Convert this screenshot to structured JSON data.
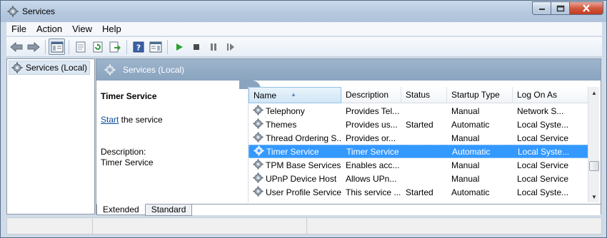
{
  "window": {
    "title": "Services",
    "controls": {
      "minimize": "minimize",
      "maximize": "maximize",
      "close": "close"
    }
  },
  "menu": [
    "File",
    "Action",
    "View",
    "Help"
  ],
  "toolbar": [
    {
      "icon": "back-arrow-icon"
    },
    {
      "icon": "forward-arrow-icon"
    },
    {
      "icon": "show-hide-console-tree-icon",
      "active": true
    },
    {
      "icon": "properties-icon"
    },
    {
      "icon": "refresh-icon"
    },
    {
      "icon": "export-list-icon"
    },
    {
      "icon": "help-icon"
    },
    {
      "icon": "show-action-pane-icon"
    },
    {
      "icon": "play-icon"
    },
    {
      "icon": "stop-icon"
    },
    {
      "icon": "pause-icon"
    },
    {
      "icon": "restart-icon"
    }
  ],
  "tree": {
    "root_label": "Services (Local)"
  },
  "pane": {
    "header_title": "Services (Local)",
    "selected_service_title": "Timer Service",
    "start_link": "Start",
    "start_suffix": " the service",
    "description_label": "Description:",
    "description_text": "Timer Service"
  },
  "columns": [
    "Name",
    "Description",
    "Status",
    "Startup Type",
    "Log On As"
  ],
  "rows": [
    {
      "name": "Telephony",
      "description": "Provides Tel...",
      "status": "",
      "startup": "Manual",
      "logon": "Network S...",
      "selected": false
    },
    {
      "name": "Themes",
      "description": "Provides us...",
      "status": "Started",
      "startup": "Automatic",
      "logon": "Local Syste...",
      "selected": false
    },
    {
      "name": "Thread Ordering S...",
      "description": "Provides or...",
      "status": "",
      "startup": "Manual",
      "logon": "Local Service",
      "selected": false
    },
    {
      "name": "Timer Service",
      "description": "Timer Service",
      "status": "",
      "startup": "Automatic",
      "logon": "Local Syste...",
      "selected": true
    },
    {
      "name": "TPM Base Services",
      "description": "Enables acc...",
      "status": "",
      "startup": "Manual",
      "logon": "Local Service",
      "selected": false
    },
    {
      "name": "UPnP Device Host",
      "description": "Allows UPn...",
      "status": "",
      "startup": "Manual",
      "logon": "Local Service",
      "selected": false
    },
    {
      "name": "User Profile Service",
      "description": "This service ...",
      "status": "Started",
      "startup": "Automatic",
      "logon": "Local Syste...",
      "selected": false
    }
  ],
  "tabs": [
    "Extended",
    "Standard"
  ],
  "colors": {
    "selection": "#3399ff",
    "header_band": "#8aa4bf",
    "link": "#0b4fa1"
  }
}
